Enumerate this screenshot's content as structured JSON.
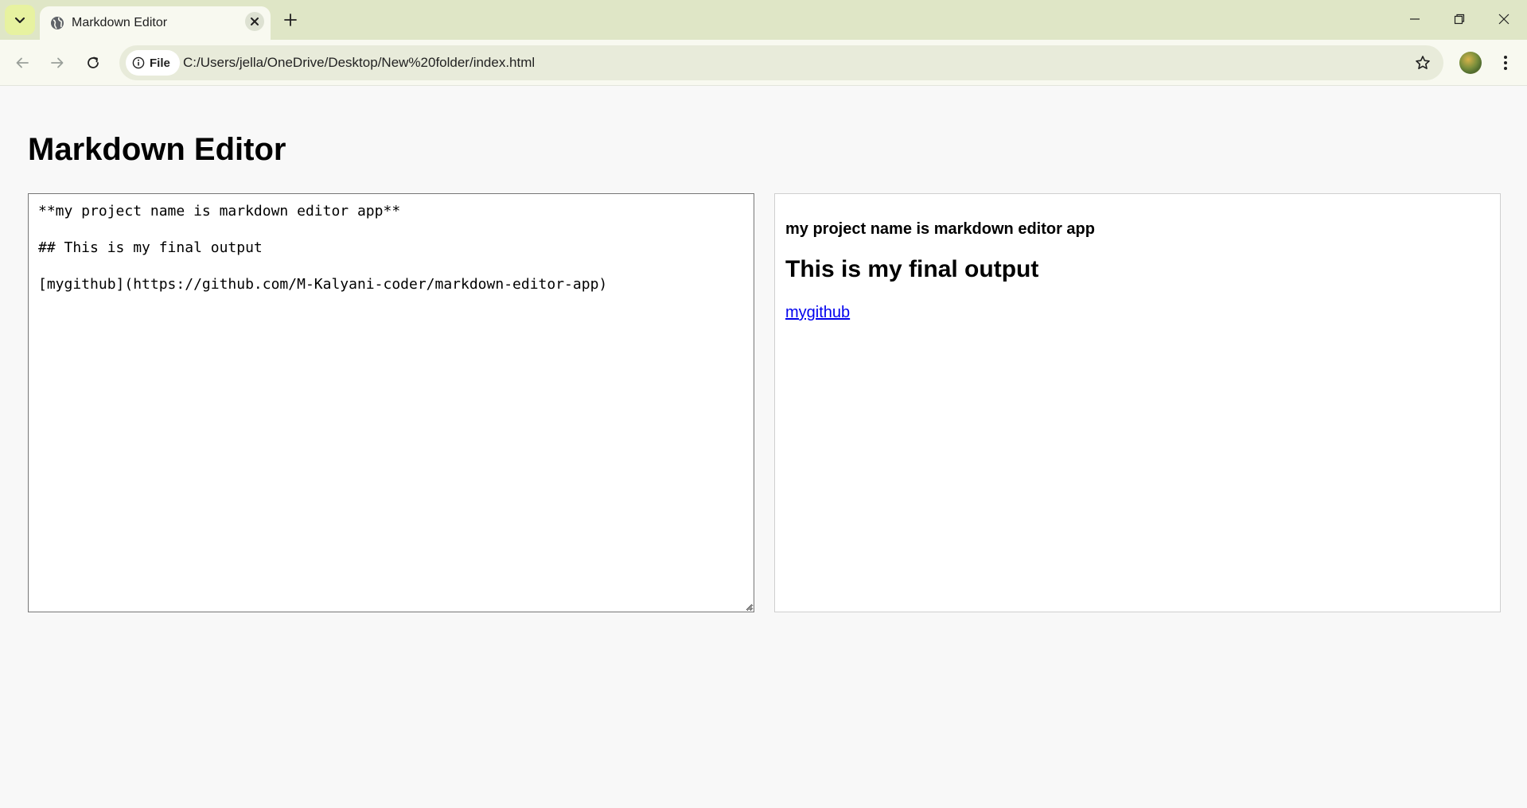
{
  "browser": {
    "tab_title": "Markdown Editor",
    "site_chip": "File",
    "url": "C:/Users/jella/OneDrive/Desktop/New%20folder/index.html"
  },
  "page": {
    "title": "Markdown Editor",
    "editor_text": "**my project name is markdown editor app**\n\n## This is my final output\n\n[mygithub](https://github.com/M-Kalyani-coder/markdown-editor-app)",
    "preview": {
      "bold_text": "my project name is markdown editor app",
      "heading": "This is my final output",
      "link_text": "mygithub"
    }
  },
  "colors": {
    "tabstrip_bg": "#dfe6c6",
    "toolbar_bg": "#f8f9f0",
    "link": "#0000ee"
  }
}
